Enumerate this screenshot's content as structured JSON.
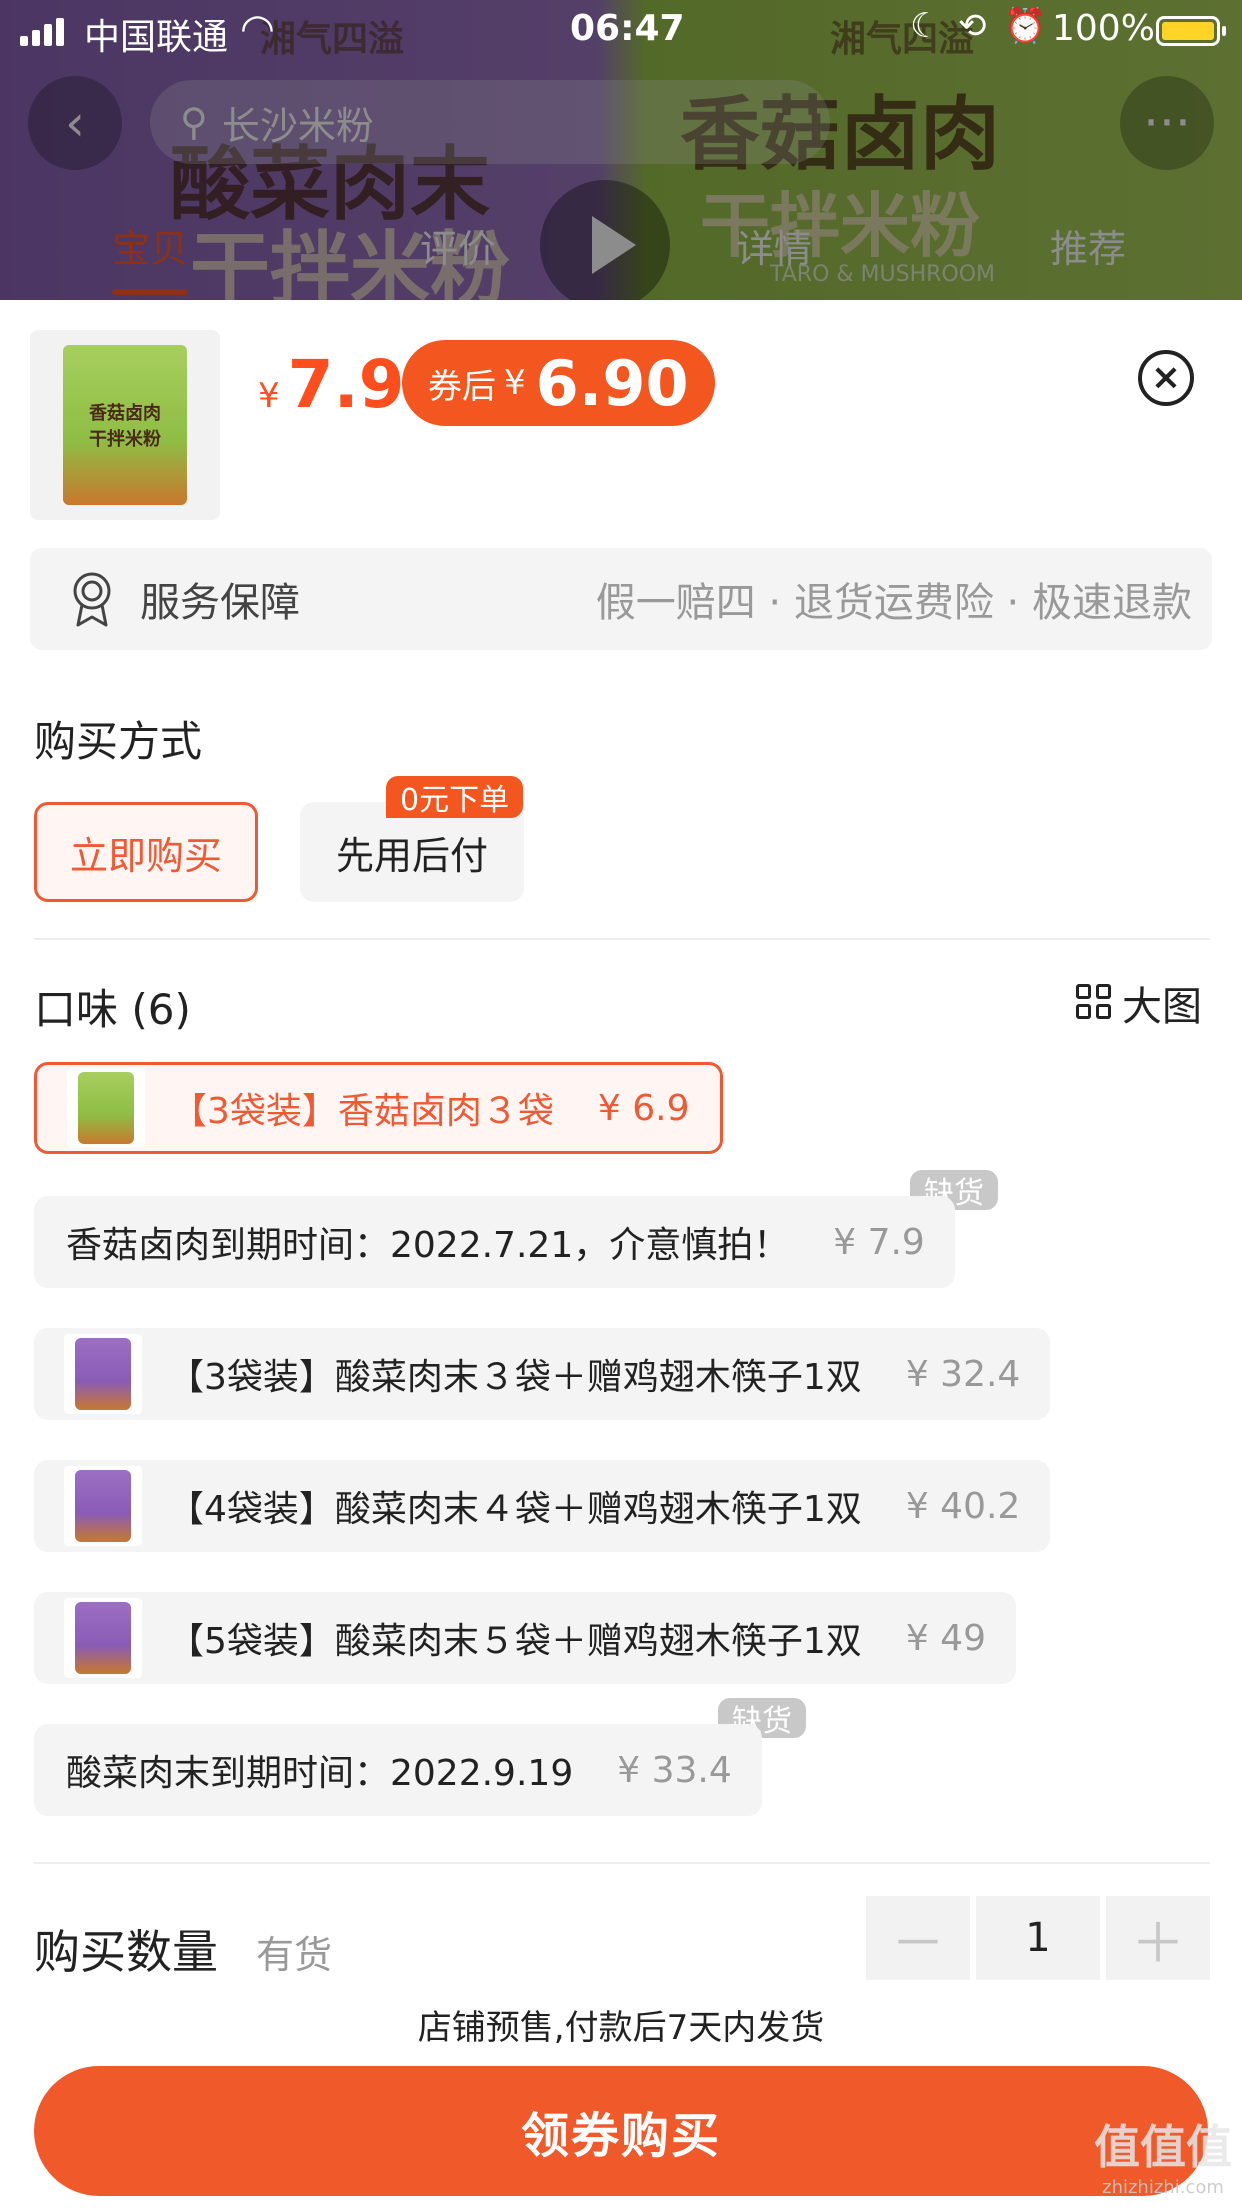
{
  "status_bar": {
    "carrier": "中国联通",
    "time": "06:47",
    "battery_percent": "100%"
  },
  "background_page": {
    "search_text": "长沙米粉",
    "tabs": [
      "宝贝",
      "评价",
      "详情",
      "推荐"
    ],
    "active_tab": "宝贝",
    "brand_text": "湘气四溢",
    "product_title_left": "酸菜肉末",
    "product_title_right": "香菇卤肉",
    "product_subtitle": "干拌米粉",
    "english_text": "TARO & MUSHROOM"
  },
  "product": {
    "price_symbol": "¥",
    "price": "7.9",
    "coupon_label": "券后",
    "coupon_symbol": "¥",
    "coupon_price": "6.90",
    "thumb_text_1": "香菇卤肉",
    "thumb_text_2": "干拌米粉",
    "close_icon": "close-circle-icon"
  },
  "service": {
    "title": "服务保障",
    "description": "假一赔四 · 退货运费险 · 极速退款",
    "icon": "badge-icon"
  },
  "purchase_method": {
    "title": "购买方式",
    "options": [
      {
        "label": "立即购买",
        "selected": true
      },
      {
        "label": "先用后付",
        "selected": false,
        "tag": "0元下单"
      }
    ]
  },
  "flavor": {
    "title": "口味 (6)",
    "big_picture_label": "大图",
    "skus": [
      {
        "label": "【3袋装】香菇卤肉３袋",
        "price": "¥ 6.9",
        "selected": true,
        "thumb": "green"
      },
      {
        "label": "香菇卤肉到期时间：2022.7.21，介意慎拍！",
        "price": "¥ 7.9",
        "out_of_stock": "缺货"
      },
      {
        "label": "【3袋装】酸菜肉末３袋＋赠鸡翅木筷子1双",
        "price": "¥ 32.4",
        "thumb": "purple"
      },
      {
        "label": "【4袋装】酸菜肉末４袋＋赠鸡翅木筷子1双",
        "price": "¥ 40.2",
        "thumb": "purple"
      },
      {
        "label": "【5袋装】酸菜肉末５袋＋赠鸡翅木筷子1双",
        "price": "¥ 49",
        "thumb": "purple"
      },
      {
        "label": "酸菜肉末到期时间：2022.9.19",
        "price": "¥ 33.4",
        "out_of_stock": "缺货"
      }
    ]
  },
  "quantity": {
    "label": "购买数量",
    "stock": "有货",
    "minus": "－",
    "value": "1",
    "plus": "＋"
  },
  "presale_note": "店铺预售,付款后7天内发货",
  "buy_button": "领券购买",
  "watermark": {
    "logo": "值值值",
    "url": "zhizhizhi.com"
  },
  "colors": {
    "accent": "#f0592a",
    "price": "#ff4e1e",
    "selected_border": "#ef5a34",
    "disabled": "#c8c8c8"
  }
}
